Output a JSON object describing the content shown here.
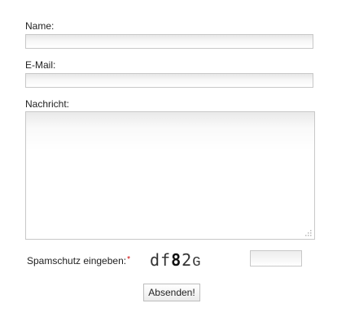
{
  "form": {
    "name_label": "Name:",
    "name_value": "",
    "email_label": "E-Mail:",
    "email_value": "",
    "message_label": "Nachricht:",
    "message_value": "",
    "spam_label": "Spamschutz eingeben:",
    "required_mark": "*",
    "captcha_chars": [
      "d",
      "f",
      "8",
      "2",
      "G"
    ],
    "captcha_value": "",
    "submit_label": "Absenden!"
  },
  "colors": {
    "required_mark": "#cc0000",
    "field_border": "#c8c8c8"
  }
}
